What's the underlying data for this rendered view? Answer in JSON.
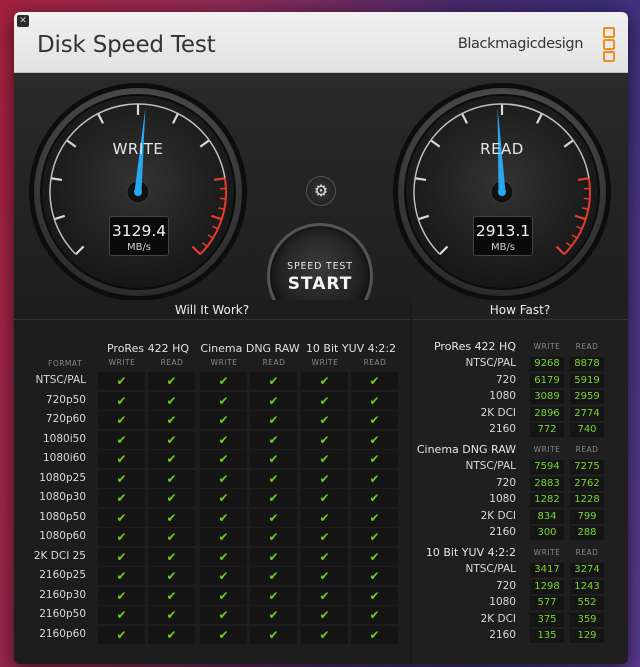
{
  "window": {
    "close_glyph": "✕",
    "title": "Disk Speed Test",
    "brand": "Blackmagicdesign",
    "brand_color": "#ee8e1e"
  },
  "gauges": {
    "write": {
      "label": "WRITE",
      "value": "3129.4",
      "unit": "MB/s",
      "needle_color": "#29a8f0"
    },
    "read": {
      "label": "READ",
      "value": "2913.1",
      "unit": "MB/s",
      "needle_color": "#29a8f0"
    }
  },
  "controls": {
    "settings_icon": "gear-icon",
    "settings_glyph": "⚙",
    "start_line1": "SPEED TEST",
    "start_line2": "START"
  },
  "will_it_work": {
    "title": "Will It Work?",
    "format_label": "FORMAT",
    "check_color": "#68d11e",
    "check_glyph": "✔",
    "groups": [
      {
        "name": "ProRes 422 HQ",
        "write": "WRITE",
        "read": "READ"
      },
      {
        "name": "Cinema DNG RAW",
        "write": "WRITE",
        "read": "READ"
      },
      {
        "name": "10 Bit YUV 4:2:2",
        "write": "WRITE",
        "read": "READ"
      }
    ],
    "rows": [
      "NTSC/PAL",
      "720p50",
      "720p60",
      "1080i50",
      "1080i60",
      "1080p25",
      "1080p30",
      "1080p50",
      "1080p60",
      "2K DCI 25",
      "2160p25",
      "2160p30",
      "2160p50",
      "2160p60"
    ]
  },
  "how_fast": {
    "title": "How Fast?",
    "groups": [
      {
        "name": "ProRes 422 HQ",
        "write": "WRITE",
        "read": "READ",
        "rows": [
          {
            "label": "NTSC/PAL",
            "write": "9268",
            "read": "8878"
          },
          {
            "label": "720",
            "write": "6179",
            "read": "5919"
          },
          {
            "label": "1080",
            "write": "3089",
            "read": "2959"
          },
          {
            "label": "2K DCI",
            "write": "2896",
            "read": "2774"
          },
          {
            "label": "2160",
            "write": "772",
            "read": "740"
          }
        ]
      },
      {
        "name": "Cinema DNG RAW",
        "write": "WRITE",
        "read": "READ",
        "rows": [
          {
            "label": "NTSC/PAL",
            "write": "7594",
            "read": "7275"
          },
          {
            "label": "720",
            "write": "2883",
            "read": "2762"
          },
          {
            "label": "1080",
            "write": "1282",
            "read": "1228"
          },
          {
            "label": "2K DCI",
            "write": "834",
            "read": "799"
          },
          {
            "label": "2160",
            "write": "300",
            "read": "288"
          }
        ]
      },
      {
        "name": "10 Bit YUV 4:2:2",
        "write": "WRITE",
        "read": "READ",
        "rows": [
          {
            "label": "NTSC/PAL",
            "write": "3417",
            "read": "3274"
          },
          {
            "label": "720",
            "write": "1298",
            "read": "1243"
          },
          {
            "label": "1080",
            "write": "577",
            "read": "552"
          },
          {
            "label": "2K DCI",
            "write": "375",
            "read": "359"
          },
          {
            "label": "2160",
            "write": "135",
            "read": "129"
          }
        ]
      }
    ]
  }
}
